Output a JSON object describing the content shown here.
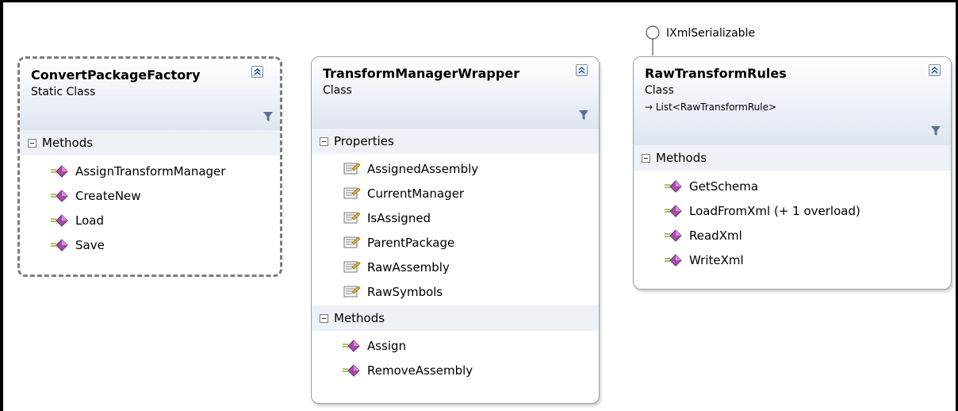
{
  "classes": [
    {
      "name": "ConvertPackageFactory",
      "kind": "Static Class",
      "sections": [
        {
          "title": "Methods",
          "items": [
            "AssignTransformManager",
            "CreateNew",
            "Load",
            "Save"
          ]
        }
      ]
    },
    {
      "name": "TransformManagerWrapper",
      "kind": "Class",
      "sections": [
        {
          "title": "Properties",
          "items": [
            "AssignedAssembly",
            "CurrentManager",
            "IsAssigned",
            "ParentPackage",
            "RawAssembly",
            "RawSymbols"
          ]
        },
        {
          "title": "Methods",
          "items": [
            "Assign",
            "RemoveAssembly"
          ]
        }
      ]
    },
    {
      "name": "RawTransformRules",
      "kind": "Class",
      "inherits": "→ List<RawTransformRule>",
      "sections": [
        {
          "title": "Methods",
          "items": [
            "GetSchema",
            "LoadFromXml (+ 1 overload)",
            "ReadXml",
            "WriteXml"
          ]
        }
      ]
    }
  ],
  "interface_lollipop": {
    "label": "IXmlSerializable"
  },
  "icons": {
    "method": "method-icon",
    "property": "property-icon",
    "collapse": "collapse-chevron-icon",
    "filter": "filter-icon"
  },
  "colors": {
    "header_bottom": "#dfe6f1",
    "section_band": "#eef1f6",
    "method_purple": "#a64ca6",
    "border": "#9e9e9e"
  }
}
